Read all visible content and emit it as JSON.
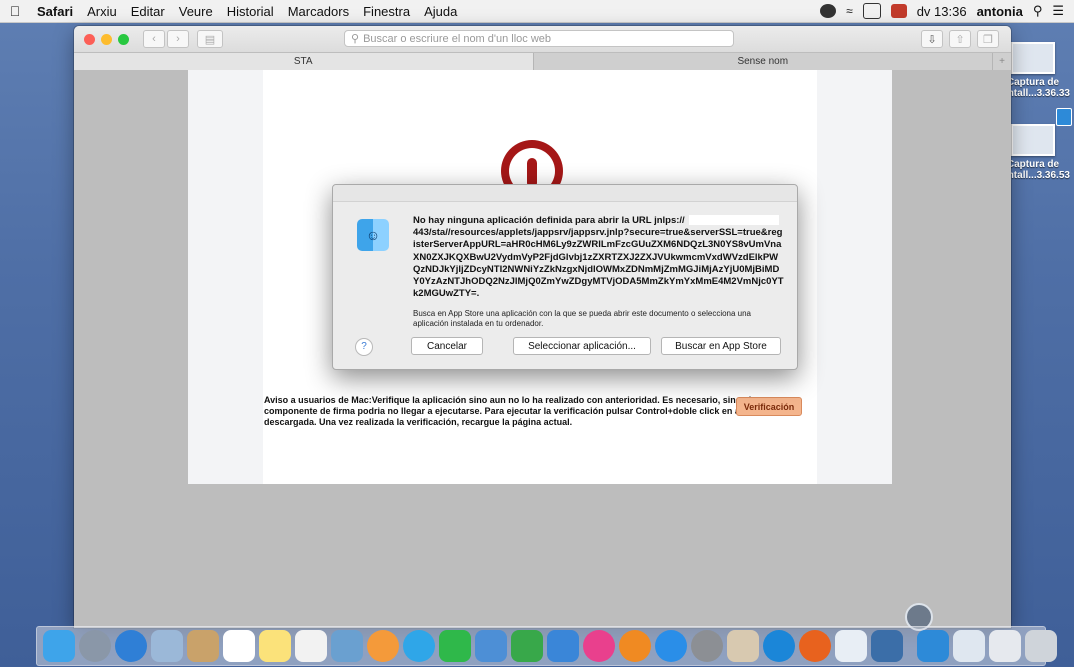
{
  "menubar": {
    "app": "Safari",
    "items": [
      "Arxiu",
      "Editar",
      "Veure",
      "Historial",
      "Marcadors",
      "Finestra",
      "Ajuda"
    ],
    "clock": "dv 13:36",
    "user": "antonia"
  },
  "desktop": {
    "icons": [
      {
        "line1": "Captura de",
        "line2": "pantall...3.36.33"
      },
      {
        "line1": "Captura de",
        "line2": "pantall...3.36.53"
      }
    ]
  },
  "browser": {
    "address_placeholder": "Buscar o escriure el nom d'un lloc web",
    "tabs": [
      "STA",
      "Sense nom"
    ],
    "tab_plus": "+"
  },
  "page": {
    "notice_text": "Aviso a usuarios de Mac:Verifique la aplicación sino aun no lo ha realizado con anterioridad. Es necesario, sino el componente de firma podria no llegar a ejecutarse. Para ejecutar la verificación pulsar Control+doble click en aplicación descargada. Una vez realizada la verificación, recargue la página actual.",
    "verify_button": "Verificación"
  },
  "dialog": {
    "heading": "No hay ninguna aplicación definida para abrir la URL jnlps://",
    "url_rest": "443/sta//resources/applets/jappsrv/jappsrv.jnlp?secure=true&serverSSL=true&registerServerAppURL=aHR0cHM6Ly9zZWRlLmFzcGUuZXM6NDQzL3N0YS8vUmVnaXN0ZXJKQXBwU2VydmVyP2FjdGlvbj1zZXRTZXJ2ZXJVUkwmcmVxdWVzdElkPWQzNDJkYjljZDcyNTI2NWNiYzZkNzgxNjdlOWMxZDNmMjZmMGJiMjAzYjU0MjBiMDY0YzAzNTJhODQ2NzJlMjQ0ZmYwZDgyMTVjODA5MmZkYmYxMmE4M2VmNjc0YTk2MGUwZTY=.",
    "sub_text": "Busca en App Store una aplicación con la que se pueda abrir este documento o selecciona una aplicación instalada en tu ordenador.",
    "help_label": "?",
    "cancel": "Cancelar",
    "choose": "Seleccionar aplicación...",
    "appstore": "Buscar en App Store"
  },
  "colors": {
    "desktop_bg": "#4f6fa6",
    "verify_btn": "#f4b58d",
    "info_red": "#a51717"
  }
}
